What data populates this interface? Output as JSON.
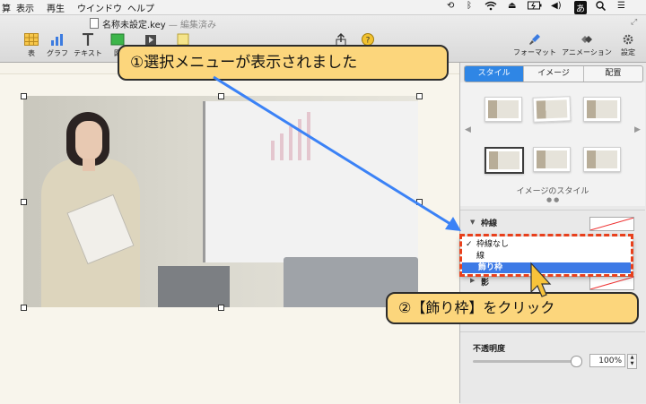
{
  "menubar": {
    "items": [
      "表示",
      "再生",
      "ウインドウ",
      "ヘルプ"
    ],
    "clipped_first": "算",
    "input_indicator": "あ"
  },
  "document": {
    "filename": "名称未設定.key",
    "status": "— 編集済み"
  },
  "toolbar": {
    "table_label": "表",
    "graph_label": "グラフ",
    "text_label": "テキスト",
    "shape_label_clipped": "図",
    "format_label": "フォーマット",
    "animation_label": "アニメーション",
    "settings_label": "設定"
  },
  "sidebar": {
    "tabs": [
      "スタイル",
      "イメージ",
      "配置"
    ],
    "active_tab": "スタイル",
    "styles_caption": "イメージのスタイル",
    "border_label": "枠線",
    "border_options": [
      "枠線なし",
      "線",
      "飾り枠"
    ],
    "checked_option": "枠線なし",
    "highlighted_option": "飾り枠",
    "shadow_label_clipped": "影",
    "opacity_label": "不透明度",
    "opacity_value": "100%",
    "opacity_fraction": 1.0
  },
  "callouts": {
    "step1": "①選択メニューが表示されました",
    "step2": "②【飾り枠】をクリック"
  },
  "colors": {
    "callout_fill": "#fcd67c",
    "highlight_dash": "#e8401c",
    "selection_blue": "#3d7ae6",
    "active_tab": "#2f86e5",
    "pointer_arrow": "#3b82f6"
  }
}
